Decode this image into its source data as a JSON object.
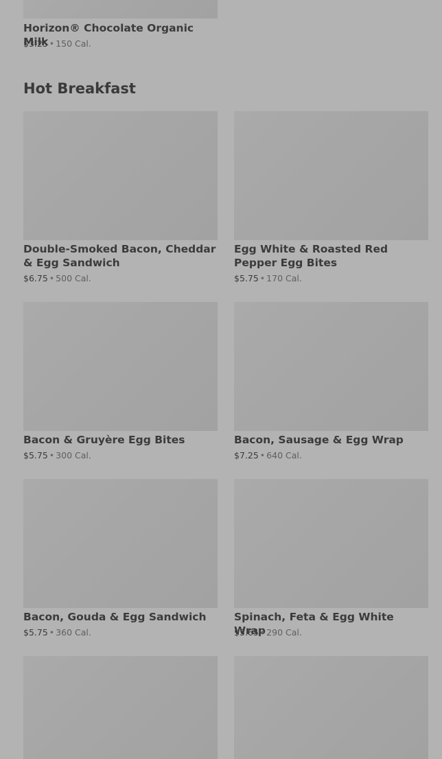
{
  "prev_section": {
    "items": [
      {
        "name": "Horizon® Chocolate Organic Milk",
        "price": "$3.25",
        "calories": "150 Cal."
      }
    ]
  },
  "hot_breakfast": {
    "title": "Hot Breakfast",
    "items": [
      {
        "name": "Double-Smoked Bacon, Cheddar & Egg Sandwich",
        "price": "$6.75",
        "calories": "500 Cal."
      },
      {
        "name": "Egg White & Roasted Red Pepper Egg Bites",
        "price": "$5.75",
        "calories": "170 Cal."
      },
      {
        "name": "Bacon & Gruyère Egg Bites",
        "price": "$5.75",
        "calories": "300 Cal."
      },
      {
        "name": "Bacon, Sausage & Egg Wrap",
        "price": "$7.25",
        "calories": "640 Cal."
      },
      {
        "name": "Bacon, Gouda & Egg Sandwich",
        "price": "$5.75",
        "calories": "360 Cal."
      },
      {
        "name": "Spinach, Feta & Egg White Wrap",
        "price": "$5.65",
        "calories": "290 Cal."
      }
    ]
  },
  "separator": "•"
}
